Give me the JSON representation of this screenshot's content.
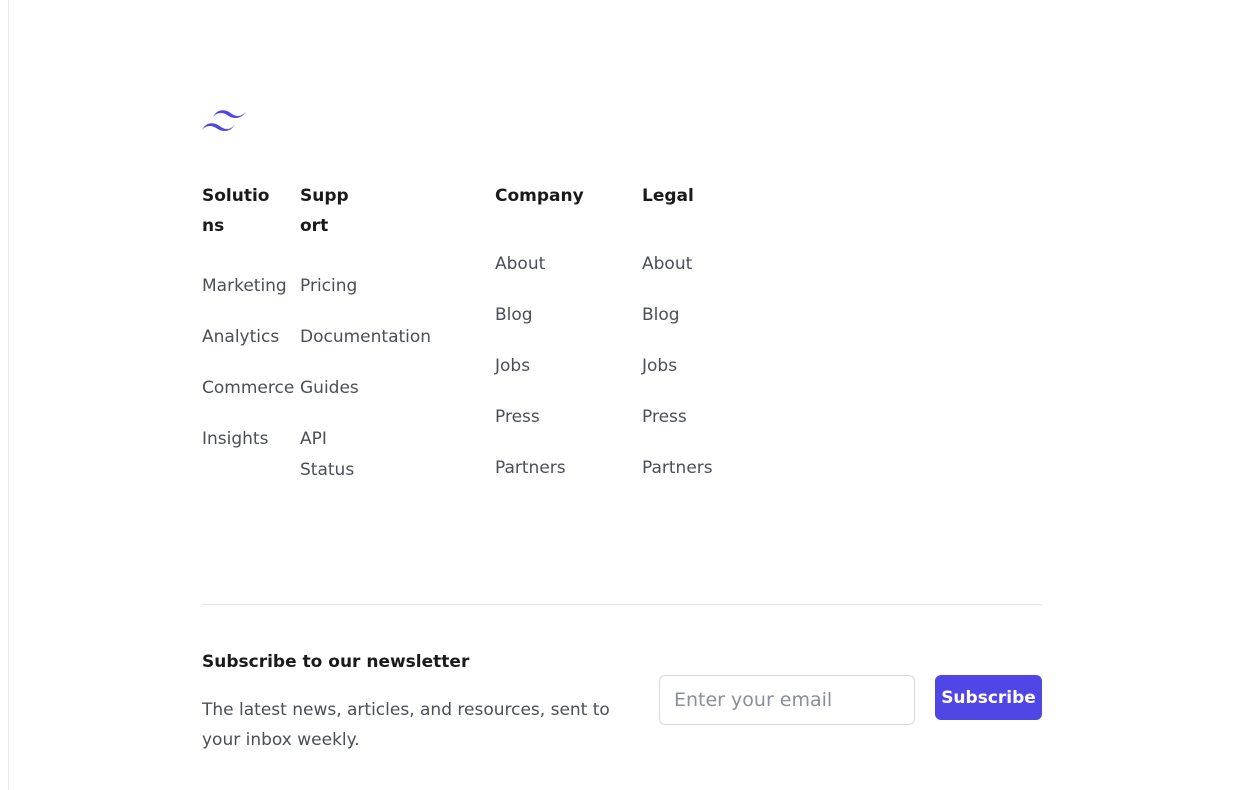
{
  "brand": {
    "logo_icon": "tailwind-waves-icon",
    "accent_color": "#5046e5"
  },
  "columns": {
    "solutions": {
      "heading": "Solutions",
      "items": [
        "Marketing",
        "Analytics",
        "Commerce",
        "Insights"
      ]
    },
    "support": {
      "heading": "Support",
      "items": [
        "Pricing",
        "Documentation",
        "Guides",
        "API Status"
      ]
    },
    "company": {
      "heading": "Company",
      "items": [
        "About",
        "Blog",
        "Jobs",
        "Press",
        "Partners"
      ]
    },
    "legal": {
      "heading": "Legal",
      "items": [
        "About",
        "Blog",
        "Jobs",
        "Press",
        "Partners"
      ]
    }
  },
  "newsletter": {
    "title": "Subscribe to our newsletter",
    "description": "The latest news, articles, and resources, sent to your inbox weekly.",
    "email_placeholder": "Enter your email",
    "email_value": "",
    "subscribe_label": "Subscribe"
  }
}
